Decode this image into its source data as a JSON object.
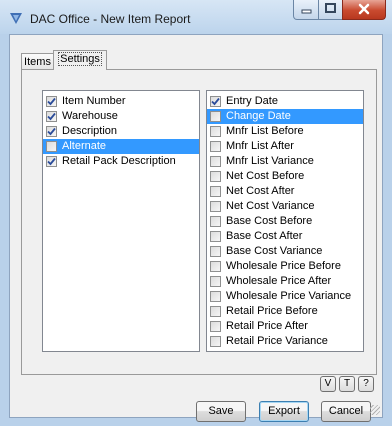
{
  "window": {
    "title": "DAC Office - New Item Report",
    "icon": "dac-logo-icon",
    "caption_buttons": [
      "minimize-icon",
      "maximize-icon",
      "close-icon"
    ]
  },
  "tabs": [
    {
      "label": "Items",
      "active": false
    },
    {
      "label": "Settings",
      "active": true
    }
  ],
  "left_list": [
    {
      "label": "Item Number",
      "checked": true,
      "selected": false
    },
    {
      "label": "Warehouse",
      "checked": true,
      "selected": false
    },
    {
      "label": "Description",
      "checked": true,
      "selected": false
    },
    {
      "label": "Alternate",
      "checked": false,
      "selected": true
    },
    {
      "label": "Retail Pack Description",
      "checked": true,
      "selected": false
    }
  ],
  "right_list": [
    {
      "label": "Entry Date",
      "checked": true,
      "selected": false
    },
    {
      "label": "Change Date",
      "checked": false,
      "selected": true
    },
    {
      "label": "Mnfr List Before",
      "checked": false,
      "selected": false
    },
    {
      "label": "Mnfr List After",
      "checked": false,
      "selected": false
    },
    {
      "label": "Mnfr List Variance",
      "checked": false,
      "selected": false
    },
    {
      "label": "Net Cost Before",
      "checked": false,
      "selected": false
    },
    {
      "label": "Net Cost After",
      "checked": false,
      "selected": false
    },
    {
      "label": "Net Cost Variance",
      "checked": false,
      "selected": false
    },
    {
      "label": "Base Cost Before",
      "checked": false,
      "selected": false
    },
    {
      "label": "Base Cost After",
      "checked": false,
      "selected": false
    },
    {
      "label": "Base Cost Variance",
      "checked": false,
      "selected": false
    },
    {
      "label": "Wholesale Price Before",
      "checked": false,
      "selected": false
    },
    {
      "label": "Wholesale Price After",
      "checked": false,
      "selected": false
    },
    {
      "label": "Wholesale Price Variance",
      "checked": false,
      "selected": false
    },
    {
      "label": "Retail Price Before",
      "checked": false,
      "selected": false
    },
    {
      "label": "Retail Price After",
      "checked": false,
      "selected": false
    },
    {
      "label": "Retail Price Variance",
      "checked": false,
      "selected": false
    }
  ],
  "small_buttons": {
    "v": "V",
    "t": "T",
    "help": "?"
  },
  "buttons": {
    "save": "Save",
    "export": "Export",
    "cancel": "Cancel"
  },
  "colors": {
    "selection": "#3399ff",
    "title_bg": "#c9ddf1",
    "close": "#c94a2f"
  }
}
